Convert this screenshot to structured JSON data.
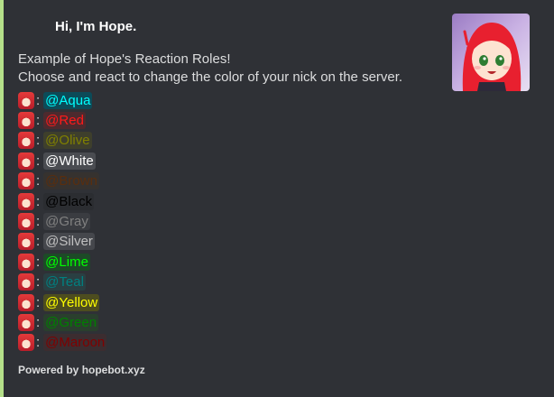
{
  "embed": {
    "author": "Hi, I'm Hope.",
    "description_lines": [
      "Example of Hope's Reaction Roles!",
      "Choose and react to change the color of your nick on the server."
    ],
    "footer": "Powered by hopebot.xyz",
    "accent_color": "#b5e08a",
    "thumbnail_icon": "hope-avatar-icon"
  },
  "roles": [
    {
      "label": "@Aqua",
      "color": "#00ffff",
      "bg": "#0c4b58"
    },
    {
      "label": "@Red",
      "color": "#ff1a1a",
      "bg": "#4d2a2e"
    },
    {
      "label": "@Olive",
      "color": "#808000",
      "bg": "#3e3f2c"
    },
    {
      "label": "@White",
      "color": "#ffffff",
      "bg": "#4a4c51"
    },
    {
      "label": "@Brown",
      "color": "#5a2e0e",
      "bg": "#36322f"
    },
    {
      "label": "@Black",
      "color": "#000000",
      "bg": "#2b2d31"
    },
    {
      "label": "@Gray",
      "color": "#808080",
      "bg": "#3a3c41"
    },
    {
      "label": "@Silver",
      "color": "#c0c0c0",
      "bg": "#45474c"
    },
    {
      "label": "@Lime",
      "color": "#00ff00",
      "bg": "#1d4a27"
    },
    {
      "label": "@Teal",
      "color": "#008080",
      "bg": "#2a3f42"
    },
    {
      "label": "@Yellow",
      "color": "#ffff00",
      "bg": "#4d4d1f"
    },
    {
      "label": "@Green",
      "color": "#008000",
      "bg": "#2a3f2d"
    },
    {
      "label": "@Maroon",
      "color": "#800000",
      "bg": "#3c2d30"
    }
  ]
}
